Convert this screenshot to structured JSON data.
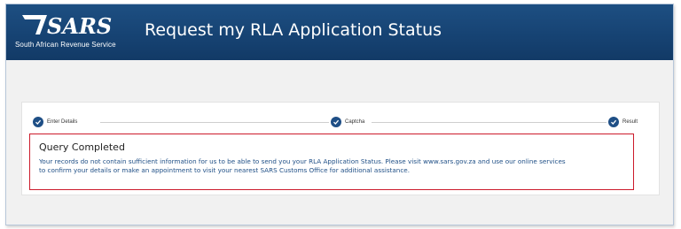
{
  "header": {
    "logo_text": "SARS",
    "logo_subtitle": "South African Revenue Service",
    "title": "Request my RLA Application Status"
  },
  "stepper": {
    "steps": [
      {
        "label": "Enter Details",
        "status": "complete",
        "icon": "check-icon"
      },
      {
        "label": "Captcha",
        "status": "complete",
        "icon": "check-icon"
      },
      {
        "label": "Result",
        "status": "complete",
        "icon": "check-icon"
      }
    ]
  },
  "result": {
    "title": "Query Completed",
    "message_line1": "Your records do not contain sufficient information for us to be able to send you your RLA Application Status.  Please visit www.sars.gov.za and use our online services",
    "message_line2": "to confirm your details or make an appointment to visit your nearest SARS Customs Office for additional assistance."
  },
  "colors": {
    "header_bg": "#164272",
    "accent": "#1f4f86",
    "alert_border": "#cc1b2b"
  }
}
